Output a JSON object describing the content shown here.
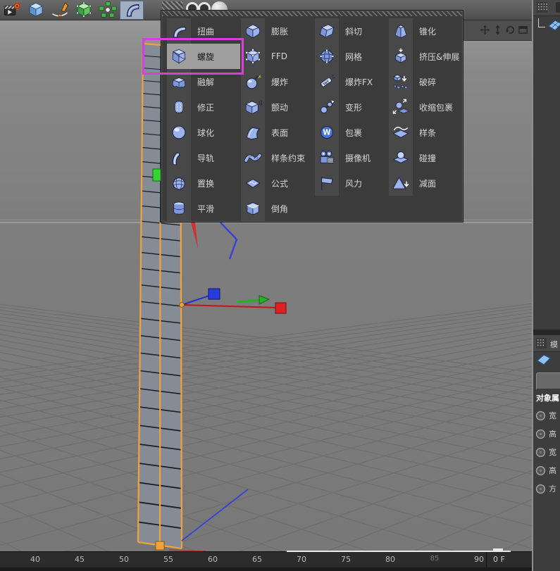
{
  "toolbar": {
    "items": [
      {
        "icon": "render-settings"
      },
      {
        "icon": "cube-primitive"
      },
      {
        "icon": "spline-pen"
      },
      {
        "icon": "editable-mesh"
      },
      {
        "icon": "array-object"
      },
      {
        "icon": "bend-deformer",
        "active": true
      }
    ]
  },
  "menu": {
    "columns": [
      {
        "items": [
          {
            "icon": "twist",
            "label": "扭曲"
          },
          {
            "icon": "spiral",
            "label": "螺旋",
            "highlighted": true
          },
          {
            "icon": "melt",
            "label": "融解"
          },
          {
            "icon": "correction",
            "label": "修正"
          },
          {
            "icon": "spherify",
            "label": "球化"
          },
          {
            "icon": "rail",
            "label": "导轨"
          },
          {
            "icon": "displace",
            "label": "置换"
          },
          {
            "icon": "smooth",
            "label": "平滑"
          }
        ]
      },
      {
        "items": [
          {
            "icon": "bulge",
            "label": "膨胀"
          },
          {
            "icon": "ffd",
            "label": "FFD"
          },
          {
            "icon": "explode",
            "label": "爆炸"
          },
          {
            "icon": "jiggle",
            "label": "颤动"
          },
          {
            "icon": "surface",
            "label": "表面"
          },
          {
            "icon": "spline-wrap",
            "label": "样条约束"
          },
          {
            "icon": "formula",
            "label": "公式"
          },
          {
            "icon": "bevel",
            "label": "倒角"
          }
        ]
      },
      {
        "items": [
          {
            "icon": "shear",
            "label": "斜切"
          },
          {
            "icon": "mesh",
            "label": "网格"
          },
          {
            "icon": "explosion-fx",
            "label": "爆炸FX"
          },
          {
            "icon": "morph",
            "label": "变形"
          },
          {
            "icon": "wrap",
            "label": "包裹"
          },
          {
            "icon": "camera-deformer",
            "label": "摄像机"
          },
          {
            "icon": "wind",
            "label": "风力"
          }
        ]
      },
      {
        "items": [
          {
            "icon": "taper",
            "label": "锥化"
          },
          {
            "icon": "squash-stretch",
            "label": "挤压&伸展"
          },
          {
            "icon": "shatter",
            "label": "破碎"
          },
          {
            "icon": "shrink-wrap",
            "label": "收缩包裹"
          },
          {
            "icon": "spline-deformer",
            "label": "样条"
          },
          {
            "icon": "collision",
            "label": "碰撞"
          },
          {
            "icon": "polygon-reduction",
            "label": "减面"
          }
        ]
      }
    ]
  },
  "annotation": {
    "color": "#d83fd8"
  },
  "viewport": {
    "nav": [
      {
        "icon": "pan"
      },
      {
        "icon": "zoom"
      },
      {
        "icon": "rotate"
      },
      {
        "icon": "toggle-view"
      }
    ]
  },
  "timeline": {
    "ticks": [
      {
        "label": "40"
      },
      {
        "label": "45"
      },
      {
        "label": "50"
      },
      {
        "label": "55"
      },
      {
        "label": "60"
      },
      {
        "label": "65"
      },
      {
        "label": "70"
      },
      {
        "label": "75"
      },
      {
        "label": "80"
      },
      {
        "label": "85",
        "dim": true
      },
      {
        "label": "90"
      }
    ],
    "frame": "0 F"
  },
  "right_panel": {
    "attribute_header": {
      "label": "模"
    },
    "section_title": "对象属",
    "rows": [
      {
        "label": "宽"
      },
      {
        "label": "高"
      },
      {
        "label": "宽"
      },
      {
        "label": "高"
      },
      {
        "label": "方"
      }
    ]
  },
  "colors": {
    "selection_orange": "#f0a23c",
    "annotation_magenta": "#d83fd8",
    "axis_x": "#e02020",
    "axis_y": "#25b025",
    "axis_z": "#2a3bdd",
    "icon_blue": "#9cb2ec"
  }
}
